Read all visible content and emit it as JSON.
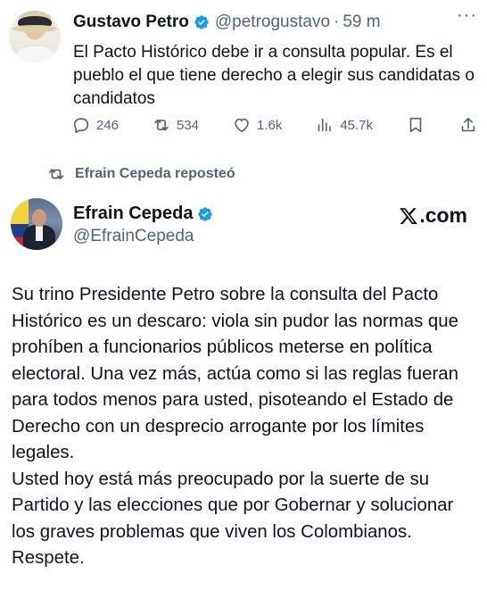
{
  "quoted_tweet": {
    "author_name": "Gustavo Petro",
    "handle": "@petrogustavo",
    "separator": "·",
    "time": "59 m",
    "text": "El Pacto Histórico debe ir a consulta popular. Es el pueblo el que tiene derecho a elegir sus candidatas o candidatos",
    "replies": "246",
    "reposts": "534",
    "likes": "1.6k",
    "views": "45.7k"
  },
  "repost_banner": {
    "text": "Efrain Cepeda reposteó"
  },
  "main_tweet": {
    "author_name": "Efrain Cepeda",
    "handle": "@EfrainCepeda",
    "paragraph1": "Su trino Presidente Petro sobre la consulta del Pacto Histórico es un descaro: viola sin pudor las normas que prohíben a funcionarios públicos meterse en política electoral. Una vez más, actúa como si las reglas fueran para todos menos para usted, pisoteando el Estado de Derecho con un desprecio arrogante por los límites legales.",
    "paragraph2": "Usted hoy está más preocupado por la suerte de su Partido y las elecciones que por Gobernar y solucionar los graves problemas que viven los Colombianos. Respete."
  },
  "watermark": {
    "text": ".com"
  },
  "colors": {
    "verified_blue": "#1d9bf0",
    "text_primary": "#0f1419",
    "text_secondary": "#536471"
  }
}
